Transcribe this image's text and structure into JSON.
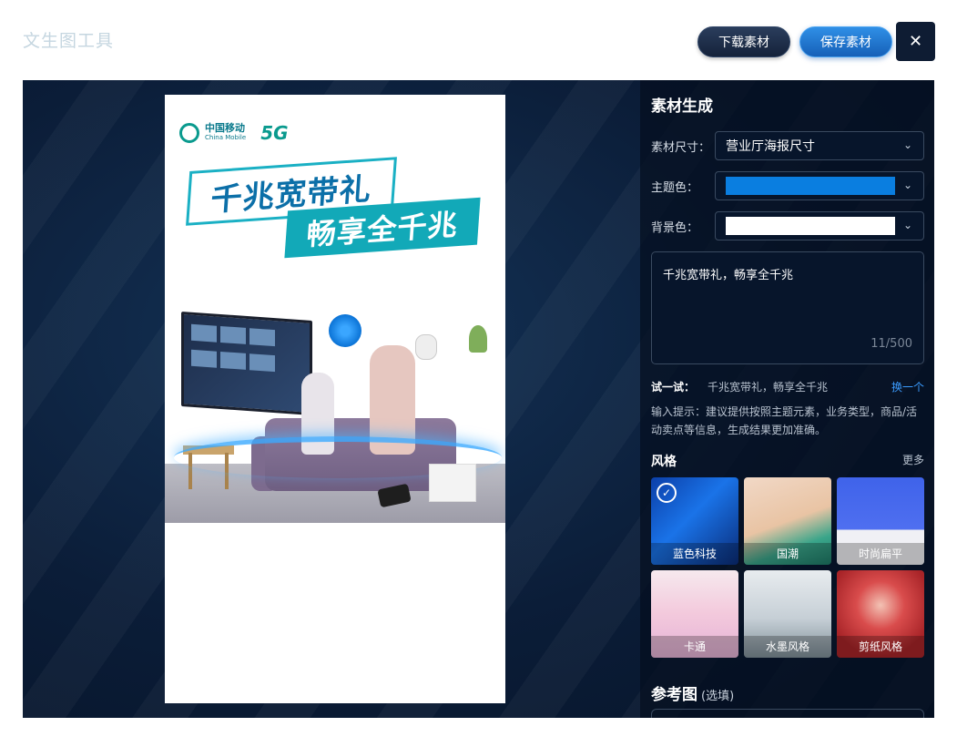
{
  "app": {
    "title": "文生图工具"
  },
  "toolbar": {
    "download_label": "下载素材",
    "save_label": "保存素材",
    "close_icon": "✕"
  },
  "poster": {
    "brand_name": "中国移动",
    "brand_sub": "China Mobile",
    "brand_5g": "5G",
    "headline_1": "千兆宽带礼",
    "headline_2": "畅享全千兆"
  },
  "panel": {
    "title": "素材生成",
    "size": {
      "label": "素材尺寸：",
      "value": "营业厅海报尺寸"
    },
    "theme_color": {
      "label": "主题色：",
      "value": "#0a7ee0"
    },
    "bg_color": {
      "label": "背景色：",
      "value": "#ffffff"
    },
    "prompt": {
      "text": "千兆宽带礼，畅享全千兆",
      "count": "11/500"
    },
    "try": {
      "label": "试一试：",
      "text": "千兆宽带礼，畅享全千兆",
      "swap": "换一个"
    },
    "hint": "输入提示：建议提供按照主题元素，业务类型，商品/活动卖点等信息，生成结果更加准确。",
    "style": {
      "title": "风格",
      "more": "更多",
      "cards": [
        {
          "label": "蓝色科技",
          "selected": true
        },
        {
          "label": "国潮",
          "selected": false
        },
        {
          "label": "时尚扁平",
          "selected": false
        },
        {
          "label": "卡通",
          "selected": false
        },
        {
          "label": "水墨风格",
          "selected": false
        },
        {
          "label": "剪纸风格",
          "selected": false
        }
      ]
    },
    "reference": {
      "title": "参考图",
      "optional": "(选填)"
    }
  },
  "colors": {
    "accent": "#3b9cff",
    "panel_bg": "#07152b"
  }
}
